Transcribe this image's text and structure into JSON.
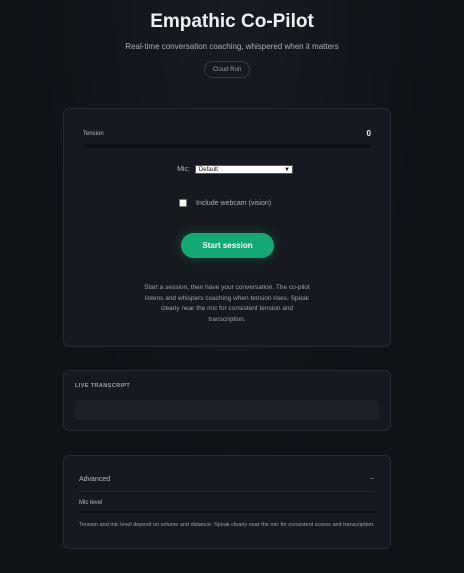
{
  "header": {
    "title": "Empathic Co-Pilot",
    "subtitle": "Real-time conversation coaching, whispered when it matters",
    "badge": "Cloud Run"
  },
  "session": {
    "tension_label": "Tension",
    "tension_value": "0",
    "tension_level": 0,
    "mic_label": "Mic:",
    "mic_selected": "Default",
    "webcam_label": "Include webcam (vision)",
    "webcam_checked": false,
    "start_button": "Start session",
    "help_text": "Start a session, then have your conversation. The co-pilot listens and whispers coaching when tension rises. Speak clearly near the mic for consistent tension and transcription."
  },
  "transcript": {
    "label": "LIVE TRANSCRIPT"
  },
  "advanced": {
    "title": "Advanced",
    "chevron_icon": "minus-icon",
    "mic_level_label": "Mic level",
    "mic_level": 0,
    "note": "Tension and mic level depend on volume and distance. Speak clearly near the mic for consistent scores and transcription."
  },
  "colors": {
    "accent": "#14a874",
    "background": "#0f1217",
    "card": "#161a20"
  }
}
